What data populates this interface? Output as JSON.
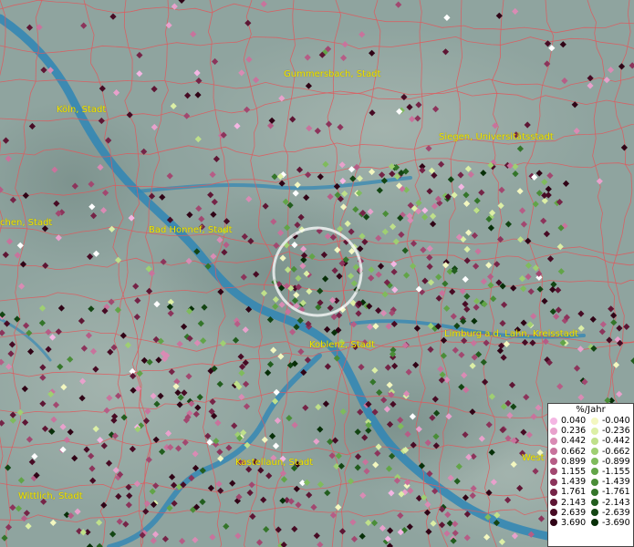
{
  "map": {
    "colors": {
      "terrain": "#8fa49f",
      "river": "#2f86b5",
      "border": "#e0585c",
      "label": "#f2e600",
      "highlight_ring": "#ffffff"
    },
    "labels": [
      {
        "text": "Köln, Stadt",
        "name": "city-label-koeln"
      },
      {
        "text": "Gummersbach, Stadt",
        "name": "city-label-gummersbach"
      },
      {
        "text": "Siegen, Universitätsstadt",
        "name": "city-label-siegen"
      },
      {
        "text": "chen, Stadt",
        "name": "city-label-chen"
      },
      {
        "text": "Bad Honnef, Stadt",
        "name": "city-label-bad-honnef"
      },
      {
        "text": "Koblenz, Stadt",
        "name": "city-label-koblenz"
      },
      {
        "text": "Limburg a.d. Lahn, Kreisstadt",
        "name": "city-label-limburg"
      },
      {
        "text": "Kastellaun, Stadt",
        "name": "city-label-kastellaun"
      },
      {
        "text": "Wittlich, Stadt",
        "name": "city-label-wittlich"
      },
      {
        "text": "West",
        "name": "city-label-west"
      }
    ]
  },
  "legend": {
    "title": "%/Jahr",
    "rows": [
      {
        "pos": "0.040",
        "pos_color": "#f4b6e3",
        "neg": "-0.040",
        "neg_color": "#f3f7c0"
      },
      {
        "pos": "0.236",
        "pos_color": "#e8a1cc",
        "neg": "-0.236",
        "neg_color": "#dcefa6"
      },
      {
        "pos": "0.442",
        "pos_color": "#d98bb4",
        "neg": "-0.442",
        "neg_color": "#bfe08a"
      },
      {
        "pos": "0.662",
        "pos_color": "#c8739c",
        "neg": "-0.662",
        "neg_color": "#9fcf72"
      },
      {
        "pos": "0.899",
        "pos_color": "#b65d86",
        "neg": "-0.899",
        "neg_color": "#7fbb5c"
      },
      {
        "pos": "1.155",
        "pos_color": "#a24870",
        "neg": "-1.155",
        "neg_color": "#62a448"
      },
      {
        "pos": "1.439",
        "pos_color": "#8c345b",
        "neg": "-1.439",
        "neg_color": "#4a8d38"
      },
      {
        "pos": "1.761",
        "pos_color": "#752447",
        "neg": "-1.761",
        "neg_color": "#34752a"
      },
      {
        "pos": "2.143",
        "pos_color": "#5e1634",
        "neg": "-2.143",
        "neg_color": "#225d1e"
      },
      {
        "pos": "2.639",
        "pos_color": "#470b24",
        "neg": "-2.639",
        "neg_color": "#134513"
      },
      {
        "pos": "3.690",
        "pos_color": "#300416",
        "neg": "-3.690",
        "neg_color": "#072f08"
      }
    ]
  }
}
